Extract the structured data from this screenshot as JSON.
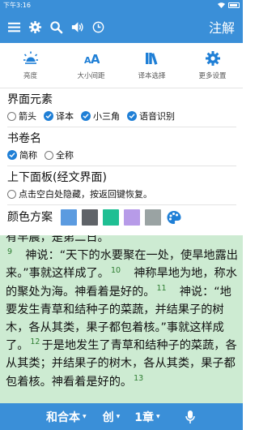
{
  "status_bar": {
    "time": "下午3:16"
  },
  "toolbar": {
    "icons": [
      "menu-icon",
      "gear-icon",
      "search-icon",
      "speaker-icon",
      "clock-icon"
    ],
    "annotation_label": "注解"
  },
  "quick_settings": [
    {
      "icon": "brightness-icon",
      "label": "亮度"
    },
    {
      "icon": "font-size-icon",
      "label": "大小间距"
    },
    {
      "icon": "books-icon",
      "label": "译本选择"
    },
    {
      "icon": "gear-icon",
      "label": "更多设置"
    }
  ],
  "ui_elements": {
    "title": "界面元素",
    "options": [
      {
        "label": "箭头",
        "checked": false
      },
      {
        "label": "译本",
        "checked": true
      },
      {
        "label": "小三角",
        "checked": true
      },
      {
        "label": "语音识别",
        "checked": true
      }
    ]
  },
  "book_name": {
    "title": "书卷名",
    "options": [
      {
        "label": "简称",
        "checked": true
      },
      {
        "label": "全称",
        "checked": false
      }
    ]
  },
  "panel_section": {
    "title": "上下面板(经文界面)",
    "option": {
      "label": "点击空白处隐藏，按返回键恢复。",
      "checked": false
    }
  },
  "color_scheme": {
    "title": "颜色方案",
    "swatches": [
      "#5b9be0",
      "#5f6368",
      "#1fbf93",
      "#b79be8",
      "#9aa3a3"
    ]
  },
  "reader": {
    "line0": "有早晨，是第二日。",
    "v9": "9",
    "text9": "神说：“天下的水要聚在一处，使旱地露出来。”事就这样成了。",
    "v10": "10",
    "text10": "神称旱地为地，称水的聚处为海。神看着是好的。",
    "v11": "11",
    "text11": "神说：“地要发生青草和结种子的菜蔬，并结果子的树木，各从其类，果子都包着核。”事就这样成了。",
    "v12": "12",
    "text12": "于是地发生了青草和结种子的菜蔬，各从其类；并结果子的树木，各从其类，果子都包着核。神看着是好的。",
    "v13": "13"
  },
  "bottom_bar": {
    "version": "和合本",
    "book": "创",
    "chapter": "1章"
  }
}
